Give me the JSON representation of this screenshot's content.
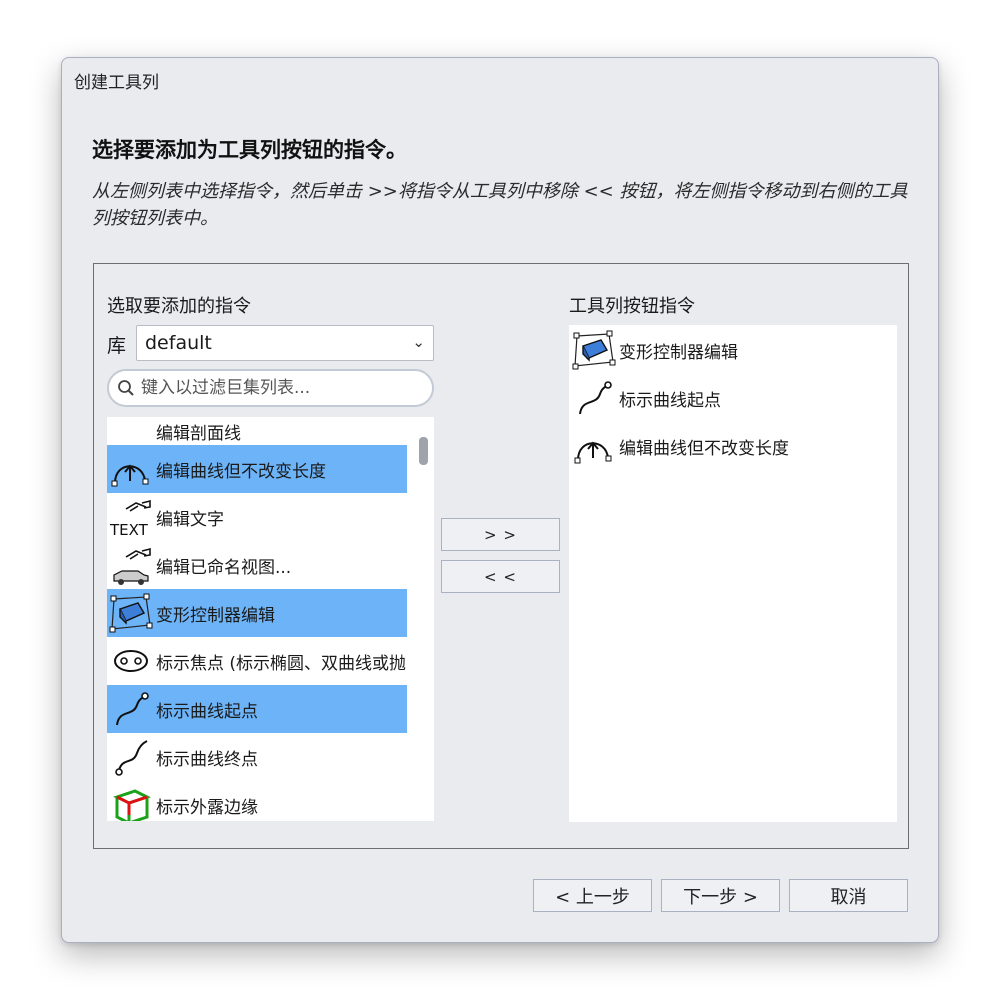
{
  "window": {
    "title": "创建工具列"
  },
  "heading": "选择要添加为工具列按钮的指令。",
  "instructions": "从左侧列表中选择指令，然后单击 >>将指令从工具列中移除 << 按钮，将左侧指令移动到右侧的工具列按钮列表中。",
  "left_panel": {
    "title": "选取要添加的指令",
    "library_label": "库",
    "library_value": "default",
    "search_placeholder": "键入以过滤巨集列表...",
    "items": [
      {
        "label": "编辑剖面线",
        "icon": "none",
        "selected": false
      },
      {
        "label": "编辑曲线但不改变长度",
        "icon": "edit-curve-keep-length-icon",
        "selected": true
      },
      {
        "label": "编辑文字",
        "icon": "edit-text-icon",
        "selected": false
      },
      {
        "label": "编辑已命名视图...",
        "icon": "edit-named-view-icon",
        "selected": false
      },
      {
        "label": "变形控制器编辑",
        "icon": "cage-edit-icon",
        "selected": true
      },
      {
        "label": "标示焦点 (标示椭圆、双曲线或抛",
        "icon": "mark-foci-icon",
        "selected": false
      },
      {
        "label": "标示曲线起点",
        "icon": "mark-curve-start-icon",
        "selected": true
      },
      {
        "label": "标示曲线终点",
        "icon": "mark-curve-end-icon",
        "selected": false
      },
      {
        "label": "标示外露边缘",
        "icon": "show-naked-edges-icon",
        "selected": false
      }
    ]
  },
  "buttons": {
    "add": "> >",
    "remove": "< <"
  },
  "right_panel": {
    "title": "工具列按钮指令",
    "items": [
      {
        "label": "变形控制器编辑",
        "icon": "cage-edit-icon"
      },
      {
        "label": "标示曲线起点",
        "icon": "mark-curve-start-icon"
      },
      {
        "label": "编辑曲线但不改变长度",
        "icon": "edit-curve-keep-length-icon"
      }
    ]
  },
  "footer": {
    "back": "< 上一步",
    "next": "下一步 >",
    "cancel": "取消"
  },
  "colors": {
    "selection": "#6cb3f8",
    "dialog_bg": "#eaebef"
  }
}
